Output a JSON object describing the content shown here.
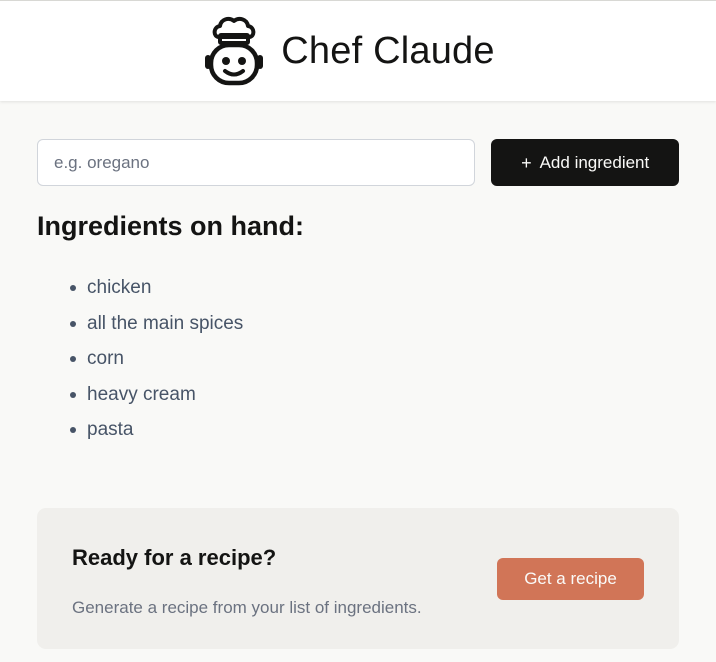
{
  "header": {
    "title": "Chef Claude",
    "logo_icon": "chef-face-icon"
  },
  "form": {
    "input_value": "",
    "input_placeholder": "e.g. oregano",
    "add_button_icon": "plus-icon",
    "add_button_plus": "+",
    "add_button_label": "Add ingredient"
  },
  "ingredients": {
    "heading": "Ingredients on hand:",
    "items": [
      "chicken",
      "all the main spices",
      "corn",
      "heavy cream",
      "pasta"
    ]
  },
  "cta": {
    "title": "Ready for a recipe?",
    "subtitle": "Generate a recipe from your list of ingredients.",
    "button_label": "Get a recipe"
  },
  "colors": {
    "accent": "#d17557",
    "dark_button": "#141413",
    "page_bg": "#f9f9f7",
    "card_bg": "#f0efec"
  }
}
